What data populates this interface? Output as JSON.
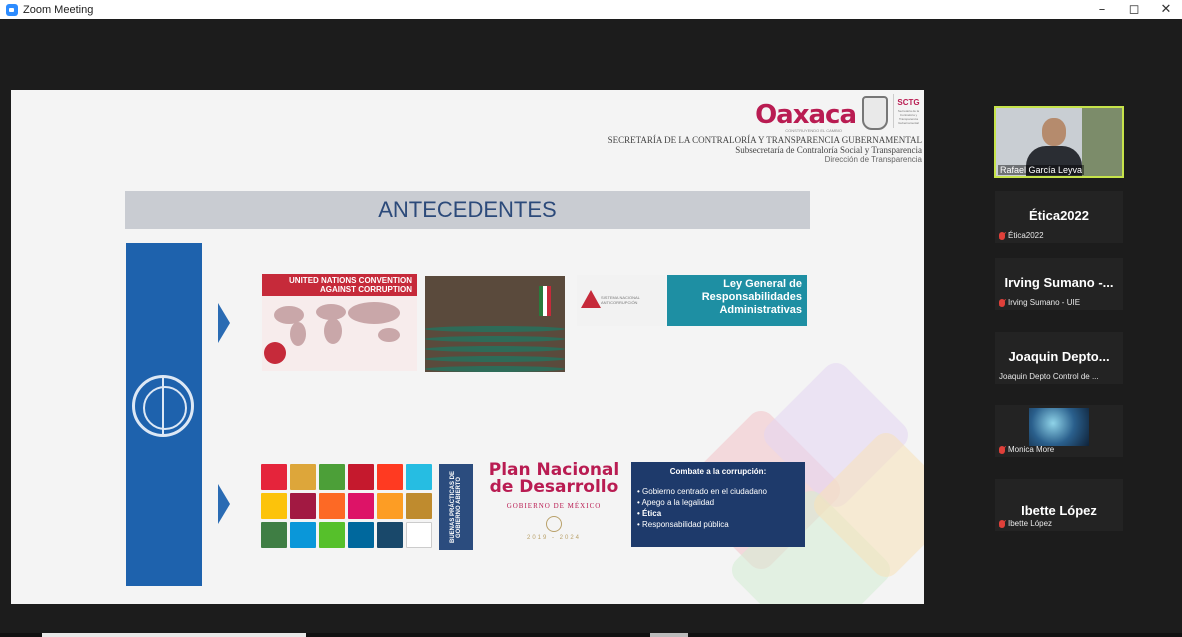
{
  "window": {
    "title": "Zoom Meeting",
    "controls": {
      "minimize": "–",
      "maximize": "◻",
      "close": "✕"
    }
  },
  "slide": {
    "header": {
      "logo": "Oaxaca",
      "logo_sub": "CONSTRUYENDO EL CAMBIO",
      "sctg": "SCTG",
      "sctg_sub": "Secretaría de la Contraloría y Transparencia Gubernamental",
      "line1": "SECRETARÍA DE LA CONTRALORÍA Y TRANSPARENCIA GUBERNAMENTAL",
      "line2": "Subsecretaría de Contraloría Social y Transparencia",
      "line3": "Dirección de Transparencia"
    },
    "banner": "ANTECEDENTES",
    "uncac_title": "UNITED NATIONS CONVENTION AGAINST CORRUPTION",
    "sna_text": "SISTEMA NACIONAL ANTICORRUPCIÓN",
    "ley_general": "Ley General de Responsabilidades Administrativas",
    "buenas_practicas": "BUENAS PRÁCTICAS DE GOBIERNO ABIERTO",
    "pnd": {
      "title": "Plan Nacional de Desarrollo",
      "gobierno": "GOBIERNO DE MÉXICO",
      "years": "2019 - 2024"
    },
    "combate": {
      "heading": "Combate a la corrupción:",
      "items": [
        "• Gobierno centrado en el ciudadano",
        "• Apego a la legalidad",
        "• Ética",
        "• Responsabilidad pública"
      ]
    },
    "sdg_colors": [
      "#e5243b",
      "#dda63a",
      "#4c9f38",
      "#c5192d",
      "#ff3a21",
      "#26bde2",
      "#fcc30b",
      "#a21942",
      "#fd6925",
      "#dd1367",
      "#fd9d24",
      "#bf8b2e",
      "#3f7e44",
      "#0a97d9",
      "#56c02b",
      "#00689d",
      "#19486a",
      "#ffffff"
    ]
  },
  "participants": {
    "self": {
      "name": "Rafael García Leyva"
    },
    "tiles": [
      {
        "display": "Ética2022",
        "name": "Ética2022",
        "muted": true
      },
      {
        "display": "Irving Sumano -...",
        "name": "Irving Sumano - UIE",
        "muted": true
      },
      {
        "display": "Joaquin Depto...",
        "name": "Joaquin Depto Control de ...",
        "muted": false
      },
      {
        "display": "",
        "name": "Monica More",
        "muted": true
      },
      {
        "display": "Ibette López",
        "name": "Ibette López",
        "muted": true
      }
    ]
  },
  "colors": {
    "accent_brand": "#b91c52",
    "un_blue": "#1e62ad",
    "active_speaker_border": "#c6e34a"
  }
}
